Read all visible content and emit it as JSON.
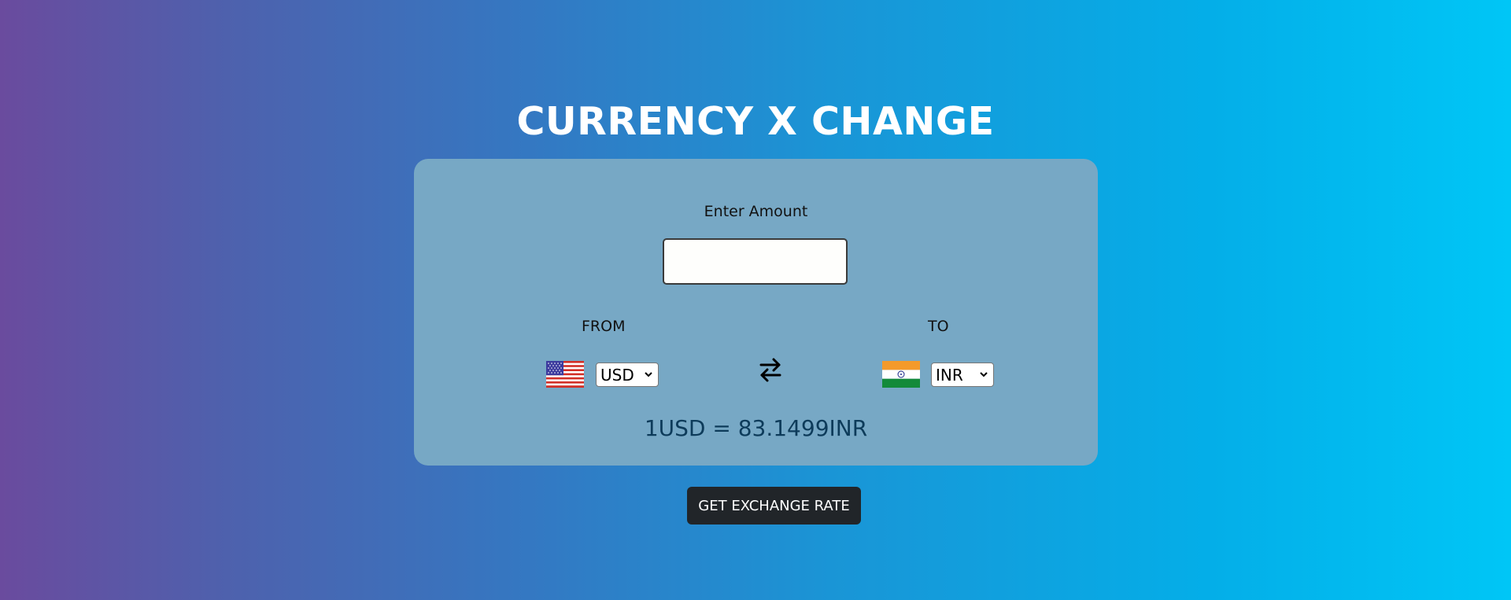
{
  "header": {
    "title": "CURRENCY X CHANGE"
  },
  "converter": {
    "amount_label": "Enter Amount",
    "amount_value": "",
    "from_label": "FROM",
    "to_label": "TO",
    "from_currency": "USD",
    "to_currency": "INR",
    "from_flag_icon": "us-flag-icon",
    "to_flag_icon": "india-flag-icon",
    "swap_icon": "swap-arrows-icon",
    "result_text": "1USD = 83.1499INR"
  },
  "actions": {
    "get_rate_label": "GET EXCHANGE RATE"
  },
  "colors": {
    "card_bg": "#77a8c5",
    "result_text": "#0d3b5a",
    "button_bg": "#212529",
    "gradient_start": "#6a4b9e",
    "gradient_end": "#00c6f6"
  }
}
